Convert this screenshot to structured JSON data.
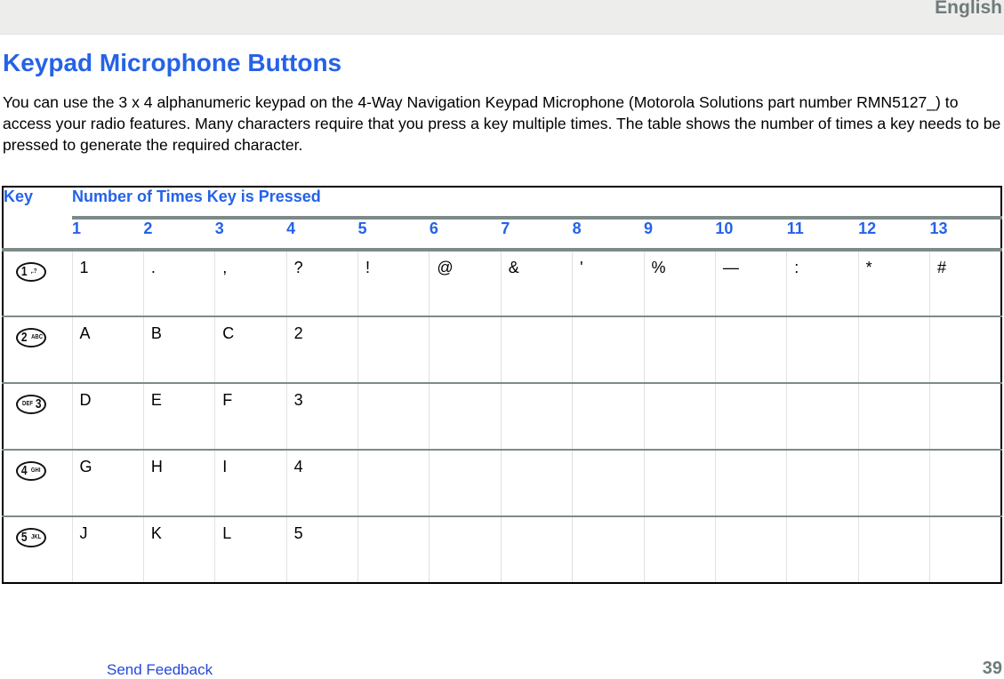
{
  "header": {
    "language": "English"
  },
  "page": {
    "title": "Keypad Microphone Buttons",
    "intro": "You can use the 3 x 4 alphanumeric keypad on the 4-Way Navigation Keypad Microphone (Motorola Solutions part number RMN5127_) to access your radio features. Many characters require that you press a key multiple times. The table shows the number of times a key needs to be pressed to generate the required character."
  },
  "table": {
    "key_header": "Key",
    "span_header": "Number of Times Key is Pressed",
    "columns": [
      "1",
      "2",
      "3",
      "4",
      "5",
      "6",
      "7",
      "8",
      "9",
      "10",
      "11",
      "12",
      "13"
    ],
    "rows": [
      {
        "key_digit": "1",
        "key_letters": ",.?",
        "key_icon": "key-1-icon",
        "layout": "left",
        "values": [
          "1",
          ".",
          ",",
          "?",
          "!",
          "@",
          "&",
          "'",
          "%",
          "—",
          ":",
          "*",
          "#"
        ]
      },
      {
        "key_digit": "2",
        "key_letters": "ABC",
        "key_icon": "key-2-abc-icon",
        "layout": "left",
        "values": [
          "A",
          "B",
          "C",
          "2",
          "",
          "",
          "",
          "",
          "",
          "",
          "",
          "",
          ""
        ]
      },
      {
        "key_digit": "3",
        "key_letters": "DEF",
        "key_icon": "key-3-def-icon",
        "layout": "right",
        "values": [
          "D",
          "E",
          "F",
          "3",
          "",
          "",
          "",
          "",
          "",
          "",
          "",
          "",
          ""
        ]
      },
      {
        "key_digit": "4",
        "key_letters": "GHI",
        "key_icon": "key-4-ghi-icon",
        "layout": "left",
        "values": [
          "G",
          "H",
          "I",
          "4",
          "",
          "",
          "",
          "",
          "",
          "",
          "",
          "",
          ""
        ]
      },
      {
        "key_digit": "5",
        "key_letters": "JKL",
        "key_icon": "key-5-jkl-icon",
        "layout": "left",
        "values": [
          "J",
          "K",
          "L",
          "5",
          "",
          "",
          "",
          "",
          "",
          "",
          "",
          "",
          ""
        ]
      }
    ]
  },
  "footer": {
    "send_feedback": "Send Feedback",
    "page_number": "39"
  }
}
